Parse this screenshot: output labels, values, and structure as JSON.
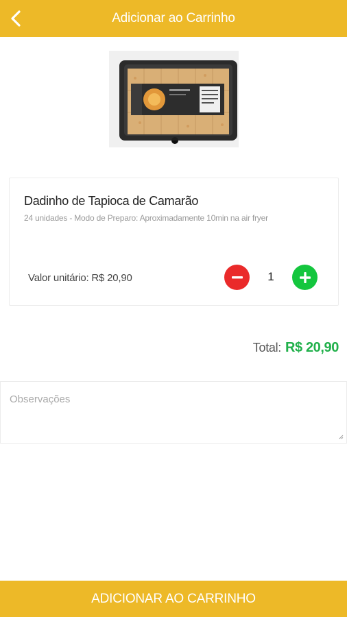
{
  "header": {
    "title": "Adicionar ao Carrinho",
    "back_icon": "chevron-left-icon"
  },
  "product": {
    "name": "Dadinho de Tapioca de Camarão",
    "description": "24 unidades - Modo de Preparo: Aproximadamente 10min na air fryer",
    "unit_price_label": "Valor unitário: R$ 20,90",
    "quantity": "1"
  },
  "total": {
    "label": "Total:",
    "value": "R$ 20,90"
  },
  "notes": {
    "placeholder": "Observações",
    "value": ""
  },
  "footer": {
    "add_button_label": "ADICIONAR AO CARRINHO"
  },
  "colors": {
    "accent": "#EDB928",
    "minus": "#EA2A2A",
    "plus": "#14C63E",
    "total_value": "#21B04B"
  }
}
